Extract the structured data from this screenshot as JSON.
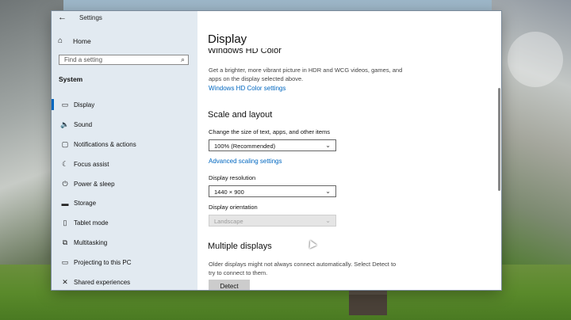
{
  "window": {
    "title": "Settings",
    "back_icon": "back-arrow-icon",
    "minimize_glyph": "—",
    "maximize_glyph": "☐",
    "close_glyph": "✕"
  },
  "sidebar": {
    "home_label": "Home",
    "search_placeholder": "Find a setting",
    "section_label": "System",
    "items": [
      {
        "label": "Display",
        "icon": "monitor-icon",
        "glyph": "▭",
        "selected": true
      },
      {
        "label": "Sound",
        "icon": "speaker-icon",
        "glyph": "🔈"
      },
      {
        "label": "Notifications & actions",
        "icon": "notifications-icon",
        "glyph": "▢"
      },
      {
        "label": "Focus assist",
        "icon": "moon-icon",
        "glyph": "☾"
      },
      {
        "label": "Power & sleep",
        "icon": "power-icon",
        "glyph": "⏻"
      },
      {
        "label": "Storage",
        "icon": "storage-icon",
        "glyph": "▬"
      },
      {
        "label": "Tablet mode",
        "icon": "tablet-icon",
        "glyph": "▯"
      },
      {
        "label": "Multitasking",
        "icon": "multitasking-icon",
        "glyph": "⧉"
      },
      {
        "label": "Projecting to this PC",
        "icon": "projecting-icon",
        "glyph": "▭"
      },
      {
        "label": "Shared experiences",
        "icon": "shared-experiences-icon",
        "glyph": "✕"
      }
    ]
  },
  "main": {
    "page_title": "Display",
    "hd_color": {
      "heading": "Windows HD Color",
      "description": "Get a brighter, more vibrant picture in HDR and WCG videos, games, and apps on the display selected above.",
      "link": "Windows HD Color settings"
    },
    "scale_layout": {
      "heading": "Scale and layout",
      "scale_label": "Change the size of text, apps, and other items",
      "scale_value": "100% (Recommended)",
      "advanced_link": "Advanced scaling settings",
      "resolution_label": "Display resolution",
      "resolution_value": "1440 × 900",
      "orientation_label": "Display orientation",
      "orientation_value": "Landscape"
    },
    "multiple_displays": {
      "heading": "Multiple displays",
      "description": "Older displays might not always connect automatically. Select Detect to try to connect to them.",
      "detect_button": "Detect"
    }
  },
  "colors": {
    "accent": "#0067c0",
    "sidebar_bg": "#e0e8f0"
  }
}
